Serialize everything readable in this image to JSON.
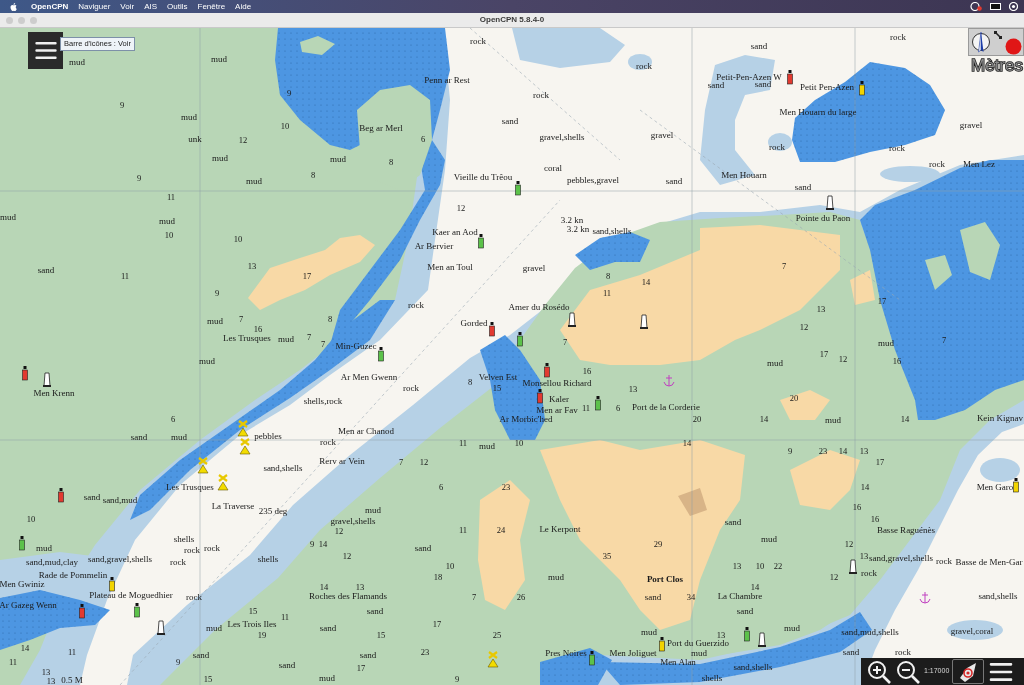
{
  "menu_bar": {
    "app_name": "OpenCPN",
    "menus": [
      "Naviguer",
      "Voir",
      "AIS",
      "Outils",
      "Fenêtre",
      "Aide"
    ]
  },
  "window": {
    "title": "OpenCPN 5.8.4-0"
  },
  "toolbar": {
    "tooltip": "Barre d'icônes : Voir"
  },
  "chart": {
    "place_names": [
      "Penn ar Rest",
      "Petit-Pen-Azen W",
      "Petit Pen-Azen",
      "Men Houarn du large",
      "Beg ar Merl",
      "Men Lez",
      "Vieille du Trêou",
      "Men Houarn",
      "Pointe du Paon",
      "Kaer an Aod",
      "Ar Bervier",
      "Men an Toul",
      "Amer du Rosédo",
      "Gorded",
      "Les Trusques",
      "Min-Guzec",
      "Ar Men Gwenn",
      "Velven Est",
      "Monsellou Richard",
      "Men Krenn",
      "Kaler",
      "Men ar Fav",
      "Port de la Corderie",
      "Ar Morbic'hed",
      "Kein Kignav",
      "Men ar Chanod",
      "Rerv ar Vein",
      "Les Trusques",
      "Men Garo",
      "La Traverse",
      "Le Kerpont",
      "Basse Raguénès",
      "Basse de Men-Gar",
      "Rade de Pommelin",
      "Men Gwiniz",
      "Plateau de Moguedhier",
      "Roches des Flamands",
      "La Chambre",
      "Ar Gazeg Wenn",
      "Les Trois Iles",
      "Port du Guerzido",
      "Pres Noires",
      "Men Joliguet",
      "Men Alan"
    ],
    "town_names": [
      "Port Clos"
    ],
    "seabed_labels": [
      "rock",
      "rock",
      "sand",
      "mud",
      "mud",
      "rock",
      "sand",
      "sand",
      "rock",
      "mud",
      "sand",
      "gravel",
      "unk",
      "gravel,shells",
      "gravel",
      "rock",
      "rock",
      "mud",
      "mud",
      "coral",
      "rock",
      "mud",
      "pebbles,gravel",
      "sand",
      "sand",
      "mud",
      "mud",
      "sand,shells",
      "sand",
      "gravel",
      "rock",
      "mud",
      "mud",
      "mud",
      "mud",
      "mud",
      "rock",
      "shells,rock",
      "mud",
      "sand",
      "mud",
      "pebbles",
      "rock",
      "mud",
      "sand,shells",
      "sand",
      "sand,mud",
      "mud",
      "gravel,shells",
      "sand",
      "shells",
      "mud",
      "mud",
      "rock",
      "rock",
      "sand",
      "sand,mud,clay",
      "sand,gravel,shells",
      "rock",
      "shells",
      "sand,gravel,shells",
      "rock",
      "mud",
      "rock",
      "rock",
      "sand",
      "sand,shells",
      "sand",
      "sand",
      "mud",
      "sand",
      "mud",
      "mud",
      "sand,mud,shells",
      "gravel,coral",
      "sand",
      "sand",
      "mud",
      "sand",
      "rock",
      "sand",
      "sand,shells",
      "mud",
      "shells"
    ],
    "soundings": [
      "9",
      "9",
      "10",
      "12",
      "6",
      "8",
      "9",
      "8",
      "11",
      "12",
      "10",
      "10",
      "13",
      "7",
      "11",
      "17",
      "8",
      "14",
      "9",
      "11",
      "17",
      "13",
      "7",
      "8",
      "16",
      "12",
      "7",
      "7",
      "7",
      "7",
      "17",
      "12",
      "16",
      "16",
      "8",
      "15",
      "13",
      "20",
      "11",
      "6",
      "6",
      "20",
      "14",
      "14",
      "11",
      "10",
      "14",
      "9",
      "23",
      "14",
      "13",
      "7",
      "12",
      "17",
      "6",
      "23",
      "14",
      "16",
      "10",
      "16",
      "12",
      "11",
      "24",
      "9",
      "14",
      "29",
      "12",
      "12",
      "35",
      "13",
      "10",
      "13",
      "10",
      "22",
      "18",
      "12",
      "14",
      "13",
      "14",
      "7",
      "26",
      "34",
      "15",
      "11",
      "17",
      "19",
      "15",
      "25",
      "13",
      "14",
      "11",
      "23",
      "11",
      "9",
      "13",
      "17",
      "13",
      "15",
      "9"
    ],
    "current_labels": [
      "3.2 kn",
      "3.2 kn"
    ],
    "bearing_label": "235 deg",
    "scale_bar_label": "0.5 M"
  },
  "units_label": "Mètres",
  "zoom_bar": {
    "scale": "1:17000"
  }
}
